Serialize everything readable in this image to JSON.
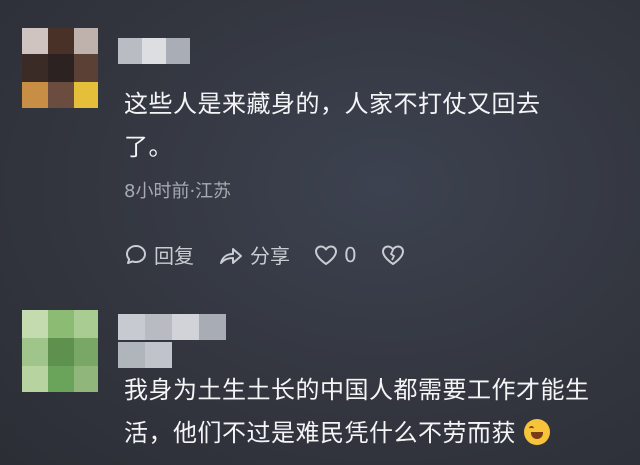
{
  "comments": [
    {
      "text_line1": "这些人是来藏身的，人家不打仗又回去",
      "text_line2": "了。",
      "meta": "8小时前·江苏",
      "actions": {
        "reply": "回复",
        "share": "分享",
        "likes": "0"
      },
      "avatar_colors": [
        "#d9cfcb",
        "#c8b8b2",
        "#5a3a2c",
        "#3a2a26",
        "#d7a36b",
        "#c98a3a",
        "#6e4f43",
        "#e7c13a",
        "#2c2a2a"
      ],
      "username_colors": [
        "#b9bcc3",
        "#d8dade",
        "#aeb2b9"
      ]
    },
    {
      "text_line1": "我身为土生土长的中国人都需要工作才能生",
      "text_line2": "活，他们不过是难民凭什么不劳而获",
      "avatar_colors": [
        "#b9d39e",
        "#8bbb73",
        "#6aa45a",
        "#c6dcb1",
        "#5d8f4c",
        "#a3c88d",
        "#7fa96d",
        "#90b67c"
      ],
      "username_colors": [
        "#c7cad0",
        "#b8bbc2",
        "#d1d3d8",
        "#a8acb4",
        "#c0c3c9",
        "#b0b4bb"
      ]
    }
  ]
}
